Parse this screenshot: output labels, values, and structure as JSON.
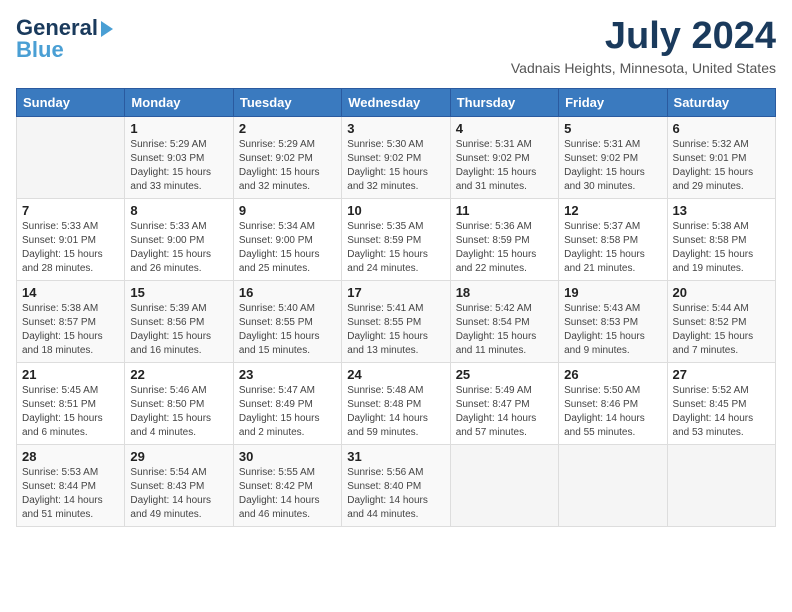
{
  "header": {
    "logo_line1": "General",
    "logo_line2": "Blue",
    "month": "July 2024",
    "location": "Vadnais Heights, Minnesota, United States"
  },
  "days_of_week": [
    "Sunday",
    "Monday",
    "Tuesday",
    "Wednesday",
    "Thursday",
    "Friday",
    "Saturday"
  ],
  "weeks": [
    [
      {
        "day": "",
        "info": ""
      },
      {
        "day": "1",
        "info": "Sunrise: 5:29 AM\nSunset: 9:03 PM\nDaylight: 15 hours\nand 33 minutes."
      },
      {
        "day": "2",
        "info": "Sunrise: 5:29 AM\nSunset: 9:02 PM\nDaylight: 15 hours\nand 32 minutes."
      },
      {
        "day": "3",
        "info": "Sunrise: 5:30 AM\nSunset: 9:02 PM\nDaylight: 15 hours\nand 32 minutes."
      },
      {
        "day": "4",
        "info": "Sunrise: 5:31 AM\nSunset: 9:02 PM\nDaylight: 15 hours\nand 31 minutes."
      },
      {
        "day": "5",
        "info": "Sunrise: 5:31 AM\nSunset: 9:02 PM\nDaylight: 15 hours\nand 30 minutes."
      },
      {
        "day": "6",
        "info": "Sunrise: 5:32 AM\nSunset: 9:01 PM\nDaylight: 15 hours\nand 29 minutes."
      }
    ],
    [
      {
        "day": "7",
        "info": "Sunrise: 5:33 AM\nSunset: 9:01 PM\nDaylight: 15 hours\nand 28 minutes."
      },
      {
        "day": "8",
        "info": "Sunrise: 5:33 AM\nSunset: 9:00 PM\nDaylight: 15 hours\nand 26 minutes."
      },
      {
        "day": "9",
        "info": "Sunrise: 5:34 AM\nSunset: 9:00 PM\nDaylight: 15 hours\nand 25 minutes."
      },
      {
        "day": "10",
        "info": "Sunrise: 5:35 AM\nSunset: 8:59 PM\nDaylight: 15 hours\nand 24 minutes."
      },
      {
        "day": "11",
        "info": "Sunrise: 5:36 AM\nSunset: 8:59 PM\nDaylight: 15 hours\nand 22 minutes."
      },
      {
        "day": "12",
        "info": "Sunrise: 5:37 AM\nSunset: 8:58 PM\nDaylight: 15 hours\nand 21 minutes."
      },
      {
        "day": "13",
        "info": "Sunrise: 5:38 AM\nSunset: 8:58 PM\nDaylight: 15 hours\nand 19 minutes."
      }
    ],
    [
      {
        "day": "14",
        "info": "Sunrise: 5:38 AM\nSunset: 8:57 PM\nDaylight: 15 hours\nand 18 minutes."
      },
      {
        "day": "15",
        "info": "Sunrise: 5:39 AM\nSunset: 8:56 PM\nDaylight: 15 hours\nand 16 minutes."
      },
      {
        "day": "16",
        "info": "Sunrise: 5:40 AM\nSunset: 8:55 PM\nDaylight: 15 hours\nand 15 minutes."
      },
      {
        "day": "17",
        "info": "Sunrise: 5:41 AM\nSunset: 8:55 PM\nDaylight: 15 hours\nand 13 minutes."
      },
      {
        "day": "18",
        "info": "Sunrise: 5:42 AM\nSunset: 8:54 PM\nDaylight: 15 hours\nand 11 minutes."
      },
      {
        "day": "19",
        "info": "Sunrise: 5:43 AM\nSunset: 8:53 PM\nDaylight: 15 hours\nand 9 minutes."
      },
      {
        "day": "20",
        "info": "Sunrise: 5:44 AM\nSunset: 8:52 PM\nDaylight: 15 hours\nand 7 minutes."
      }
    ],
    [
      {
        "day": "21",
        "info": "Sunrise: 5:45 AM\nSunset: 8:51 PM\nDaylight: 15 hours\nand 6 minutes."
      },
      {
        "day": "22",
        "info": "Sunrise: 5:46 AM\nSunset: 8:50 PM\nDaylight: 15 hours\nand 4 minutes."
      },
      {
        "day": "23",
        "info": "Sunrise: 5:47 AM\nSunset: 8:49 PM\nDaylight: 15 hours\nand 2 minutes."
      },
      {
        "day": "24",
        "info": "Sunrise: 5:48 AM\nSunset: 8:48 PM\nDaylight: 14 hours\nand 59 minutes."
      },
      {
        "day": "25",
        "info": "Sunrise: 5:49 AM\nSunset: 8:47 PM\nDaylight: 14 hours\nand 57 minutes."
      },
      {
        "day": "26",
        "info": "Sunrise: 5:50 AM\nSunset: 8:46 PM\nDaylight: 14 hours\nand 55 minutes."
      },
      {
        "day": "27",
        "info": "Sunrise: 5:52 AM\nSunset: 8:45 PM\nDaylight: 14 hours\nand 53 minutes."
      }
    ],
    [
      {
        "day": "28",
        "info": "Sunrise: 5:53 AM\nSunset: 8:44 PM\nDaylight: 14 hours\nand 51 minutes."
      },
      {
        "day": "29",
        "info": "Sunrise: 5:54 AM\nSunset: 8:43 PM\nDaylight: 14 hours\nand 49 minutes."
      },
      {
        "day": "30",
        "info": "Sunrise: 5:55 AM\nSunset: 8:42 PM\nDaylight: 14 hours\nand 46 minutes."
      },
      {
        "day": "31",
        "info": "Sunrise: 5:56 AM\nSunset: 8:40 PM\nDaylight: 14 hours\nand 44 minutes."
      },
      {
        "day": "",
        "info": ""
      },
      {
        "day": "",
        "info": ""
      },
      {
        "day": "",
        "info": ""
      }
    ]
  ]
}
